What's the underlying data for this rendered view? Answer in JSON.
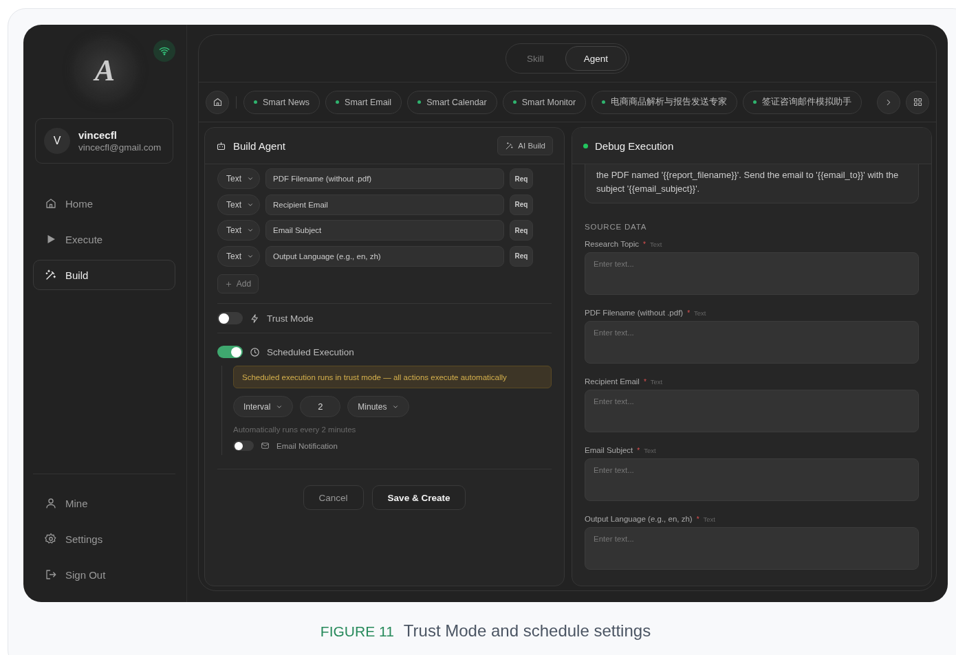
{
  "sidebar": {
    "logo_letter": "A",
    "user": {
      "initial": "V",
      "name": "vincecfl",
      "email": "vincecfl@gmail.com"
    },
    "nav": [
      {
        "label": "Home",
        "selected": false
      },
      {
        "label": "Execute",
        "selected": false
      },
      {
        "label": "Build",
        "selected": true
      }
    ],
    "bottom_nav": [
      {
        "label": "Mine"
      },
      {
        "label": "Settings"
      },
      {
        "label": "Sign Out"
      }
    ]
  },
  "mode_switch": [
    {
      "label": "Skill",
      "selected": false
    },
    {
      "label": "Agent",
      "selected": true
    }
  ],
  "agent_tabs": [
    "Smart News",
    "Smart Email",
    "Smart Calendar",
    "Smart Monitor",
    "电商商品解析与报告发送专家",
    "签证咨询邮件模拟助手"
  ],
  "build_panel": {
    "title": "Build Agent",
    "ai_build": "AI Build",
    "params": [
      {
        "type": "Text",
        "name": "PDF Filename (without .pdf)",
        "required": "Req"
      },
      {
        "type": "Text",
        "name": "Recipient Email",
        "required": "Req"
      },
      {
        "type": "Text",
        "name": "Email Subject",
        "required": "Req"
      },
      {
        "type": "Text",
        "name": "Output Language (e.g., en, zh)",
        "required": "Req"
      }
    ],
    "add": "Add",
    "trust_mode": {
      "label": "Trust Mode",
      "on": false
    },
    "schedule": {
      "label": "Scheduled Execution",
      "on": true,
      "warning": "Scheduled execution runs in trust mode — all actions execute automatically",
      "mode": "Interval",
      "value": "2",
      "unit": "Minutes",
      "hint": "Automatically runs every 2 minutes",
      "email_notification": {
        "label": "Email Notification",
        "on": false
      }
    },
    "cancel": "Cancel",
    "save": "Save & Create"
  },
  "debug_panel": {
    "title": "Debug Execution",
    "prompt": "the PDF named '{{report_filename}}'. Send the email to '{{email_to}}' with the subject '{{email_subject}}'.",
    "section": "SOURCE DATA",
    "fields": [
      {
        "label": "Research Topic",
        "mark": "*",
        "type": "Text",
        "placeholder": "Enter text..."
      },
      {
        "label": "PDF Filename (without .pdf)",
        "mark": "*",
        "type": "Text",
        "placeholder": "Enter text..."
      },
      {
        "label": "Recipient Email",
        "mark": "*",
        "type": "Text",
        "placeholder": "Enter text..."
      },
      {
        "label": "Email Subject",
        "mark": "*",
        "type": "Text",
        "placeholder": "Enter text..."
      },
      {
        "label": "Output Language (e.g., en, zh)",
        "mark": "*",
        "type": "Text",
        "placeholder": "Enter text..."
      }
    ]
  },
  "caption": {
    "figure": "FIGURE 11",
    "text": "Trust Mode and schedule settings"
  }
}
